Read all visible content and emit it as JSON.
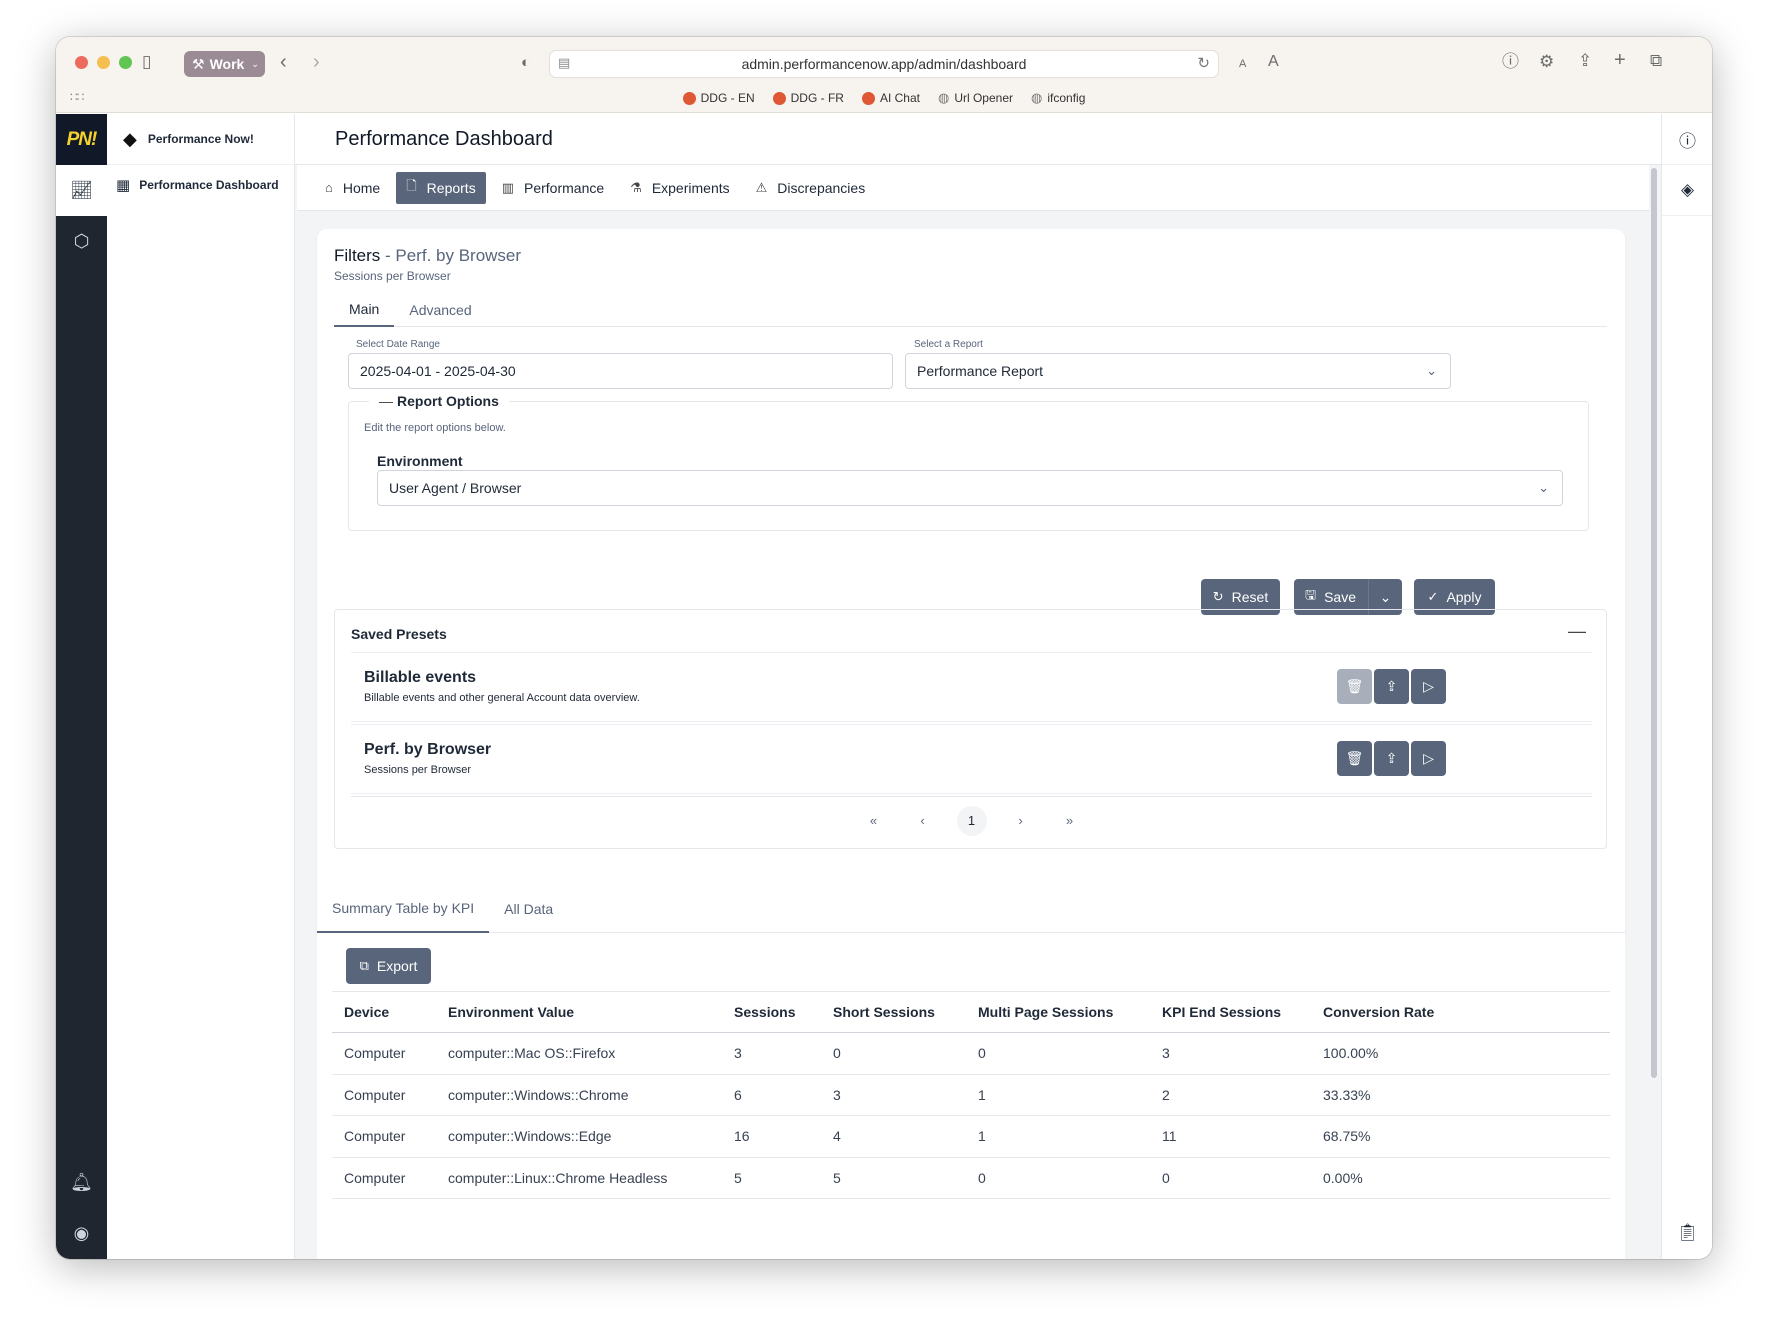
{
  "browser": {
    "profile": "Work",
    "url": "admin.performancenow.app/admin/dashboard",
    "bookmarks": [
      "DDG - EN",
      "DDG - FR",
      "AI Chat",
      "Url Opener",
      "ifconfig"
    ]
  },
  "app": {
    "logo": "PN!",
    "brand": "Performance Now!",
    "sidebar_item": "Performance Dashboard",
    "page_title": "Performance Dashboard"
  },
  "nav": {
    "tabs": [
      "Home",
      "Reports",
      "Performance",
      "Experiments",
      "Discrepancies"
    ],
    "active": "Reports"
  },
  "filters": {
    "title": "Filters",
    "title_sep": " - ",
    "preset_name": "Perf. by Browser",
    "subtitle": "Sessions per Browser",
    "tabs": [
      "Main",
      "Advanced"
    ],
    "date_label": "Select Date Range",
    "date_value": "2025-04-01 - 2025-04-30",
    "report_label": "Select a Report",
    "report_value": "Performance Report",
    "options_legend": "Report Options",
    "options_help": "Edit the report options below.",
    "env_label": "Environment",
    "env_value": "User Agent / Browser",
    "reset_label": "Reset",
    "save_label": "Save",
    "apply_label": "Apply"
  },
  "presets": {
    "title": "Saved Presets",
    "items": [
      {
        "name": "Billable events",
        "desc": "Billable events and other general Account data overview."
      },
      {
        "name": "Perf. by Browser",
        "desc": "Sessions per Browser"
      }
    ],
    "page": "1"
  },
  "summary": {
    "tabs": [
      "Summary Table by KPI",
      "All Data"
    ],
    "export_label": "Export",
    "columns": [
      "Device",
      "Environment Value",
      "Sessions",
      "Short Sessions",
      "Multi Page Sessions",
      "KPI End Sessions",
      "Conversion Rate"
    ],
    "rows": [
      [
        "Computer",
        "computer::Mac OS::Firefox",
        "3",
        "0",
        "0",
        "3",
        "100.00%"
      ],
      [
        "Computer",
        "computer::Windows::Chrome",
        "6",
        "3",
        "1",
        "2",
        "33.33%"
      ],
      [
        "Computer",
        "computer::Windows::Edge",
        "16",
        "4",
        "1",
        "11",
        "68.75%"
      ],
      [
        "Computer",
        "computer::Linux::Chrome Headless",
        "5",
        "5",
        "0",
        "0",
        "0.00%"
      ]
    ]
  },
  "colors": {
    "accent": "#58657a",
    "rail": "#1f2630",
    "logo_yellow": "#f5d22b"
  }
}
